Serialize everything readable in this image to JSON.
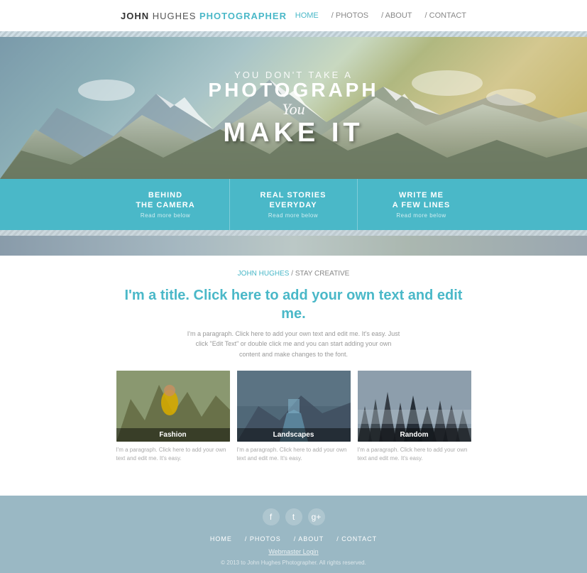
{
  "header": {
    "logo_first": "JOHN",
    "logo_last": "HUGHES",
    "logo_title": "PHOTOGRAPHER",
    "nav": [
      {
        "label": "HOME",
        "active": true
      },
      {
        "label": "/ PHOTOS",
        "active": false
      },
      {
        "label": "/ ABOUT",
        "active": false
      },
      {
        "label": "/ CONTACT",
        "active": false
      }
    ]
  },
  "hero": {
    "line1": "YOU DON'T TAKE A",
    "line2": "PHOTOGRAPH",
    "line3": "You",
    "line4": "MAKE IT"
  },
  "info_bar": {
    "items": [
      {
        "title": "BEHIND\nTHE CAMERA",
        "sub": "Read more below"
      },
      {
        "title": "REAL STORIES\nEVERYDAY",
        "sub": "Read more below"
      },
      {
        "title": "WRITE ME\nA FEW LINES",
        "sub": "Read more below"
      }
    ]
  },
  "main_section": {
    "breadcrumb_link": "JOHN HUGHES",
    "breadcrumb_sep": " / ",
    "breadcrumb_text": "STAY CREATIVE",
    "title": "I'm a title. Click here to add your own text and edit me.",
    "paragraph": "I'm a paragraph. Click here to add your own text and edit me. It's easy. Just click \"Edit Text\" or double click me and you can start adding your own content and make changes to the font.",
    "photos": [
      {
        "label": "Fashion",
        "caption": "I'm a paragraph. Click here to add your own text and edit me. It's easy."
      },
      {
        "label": "Landscapes",
        "caption": "I'm a paragraph. Click here to add your own text and edit me. It's easy."
      },
      {
        "label": "Random",
        "caption": "I'm a paragraph. Click here to add your own text and edit me. It's easy."
      }
    ]
  },
  "footer": {
    "social": [
      {
        "icon": "f",
        "name": "facebook"
      },
      {
        "icon": "t",
        "name": "twitter"
      },
      {
        "icon": "g",
        "name": "google-plus"
      }
    ],
    "nav": [
      {
        "label": "HOME"
      },
      {
        "label": "/ PHOTOS"
      },
      {
        "label": "/ ABOUT"
      },
      {
        "label": "/ CONTACT"
      }
    ],
    "webmaster": "Webmaster Login",
    "copyright": "© 2013 to John Hughes Photographer. All rights reserved."
  }
}
